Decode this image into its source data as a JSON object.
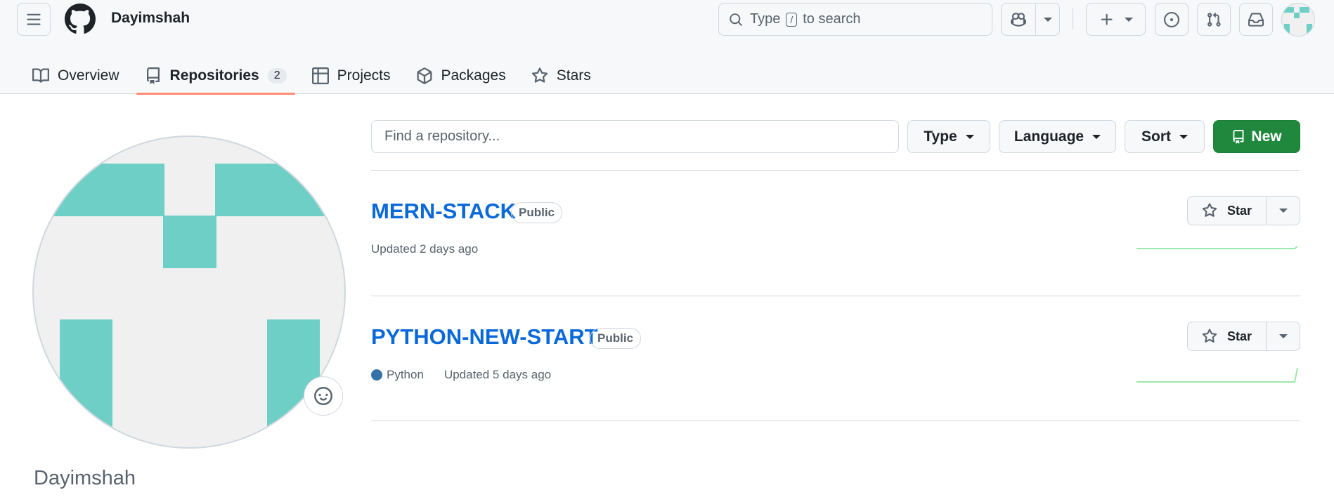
{
  "header": {
    "username": "Dayimshah",
    "search": {
      "prefix": "Type",
      "key": "/",
      "suffix": "to search"
    }
  },
  "tabs": [
    {
      "label": "Overview",
      "icon": "book-icon"
    },
    {
      "label": "Repositories",
      "icon": "repo-icon",
      "count": "2"
    },
    {
      "label": "Projects",
      "icon": "table-icon"
    },
    {
      "label": "Packages",
      "icon": "package-icon"
    },
    {
      "label": "Stars",
      "icon": "star-icon"
    }
  ],
  "profile": {
    "name": "Dayimshah"
  },
  "toolbar": {
    "find_placeholder": "Find a repository...",
    "type_label": "Type",
    "language_label": "Language",
    "sort_label": "Sort",
    "new_label": "New"
  },
  "repos": [
    {
      "name": "MERN-STACK",
      "visibility": "Public",
      "language": "",
      "updated": "Updated 2 days ago",
      "star_label": "Star"
    },
    {
      "name": "PYTHON-NEW-START",
      "visibility": "Public",
      "language": "Python",
      "language_color": "#3572a5",
      "updated": "Updated 5 days ago",
      "star_label": "Star"
    }
  ],
  "colors": {
    "accent": "#0969da",
    "new_button": "#1f883d",
    "tab_underline": "#fd8c73",
    "identicon": "#6ecfc6"
  }
}
